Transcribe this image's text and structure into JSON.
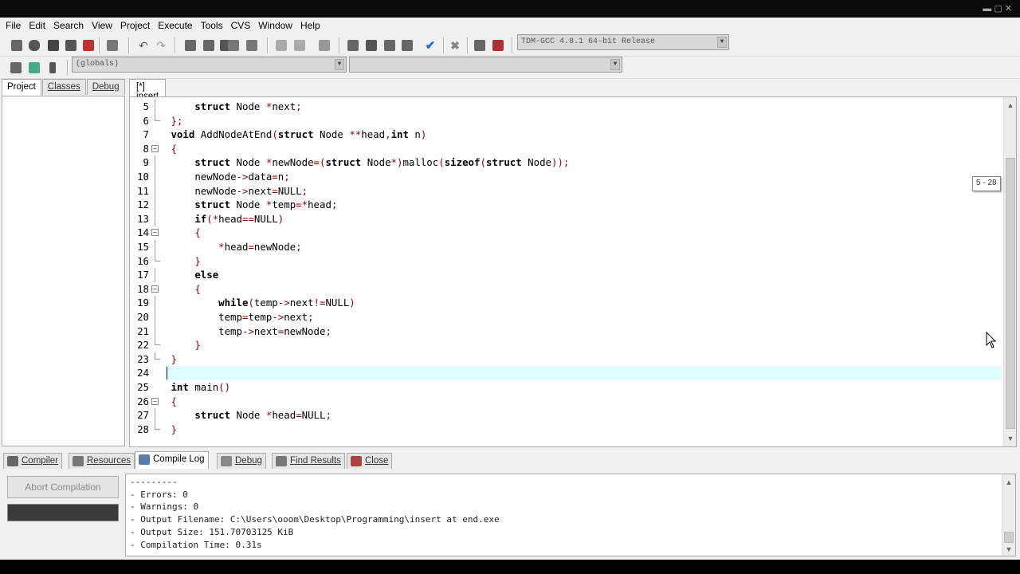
{
  "menubar": {
    "items": [
      "File",
      "Edit",
      "Search",
      "View",
      "Project",
      "Execute",
      "Tools",
      "CVS",
      "Window",
      "Help"
    ]
  },
  "toolbar": {
    "compiler_select": "TDM-GCC 4.8.1 64-bit Release",
    "scope_select": "(globals)"
  },
  "left_panel": {
    "tabs": [
      "Project",
      "Classes",
      "Debug"
    ]
  },
  "editor": {
    "tab_label": "[*] insert at end.c",
    "tooltip": "5 - 28",
    "lines": [
      {
        "num": "5",
        "text": "    struct Node *next;"
      },
      {
        "num": "6",
        "text": "};"
      },
      {
        "num": "7",
        "text": "void AddNodeAtEnd(struct Node **head,int n)"
      },
      {
        "num": "8",
        "text": "{"
      },
      {
        "num": "9",
        "text": "    struct Node *newNode=(struct Node*)malloc(sizeof(struct Node));"
      },
      {
        "num": "10",
        "text": "    newNode->data=n;"
      },
      {
        "num": "11",
        "text": "    newNode->next=NULL;"
      },
      {
        "num": "12",
        "text": "    struct Node *temp=*head;"
      },
      {
        "num": "13",
        "text": "    if(*head==NULL)"
      },
      {
        "num": "14",
        "text": "    {"
      },
      {
        "num": "15",
        "text": "        *head=newNode;"
      },
      {
        "num": "16",
        "text": "    }"
      },
      {
        "num": "17",
        "text": "    else"
      },
      {
        "num": "18",
        "text": "    {"
      },
      {
        "num": "19",
        "text": "        while(temp->next!=NULL)"
      },
      {
        "num": "20",
        "text": "        temp=temp->next;"
      },
      {
        "num": "21",
        "text": "        temp->next=newNode;"
      },
      {
        "num": "22",
        "text": "    }"
      },
      {
        "num": "23",
        "text": "}"
      },
      {
        "num": "24",
        "text": ""
      },
      {
        "num": "25",
        "text": "int main()"
      },
      {
        "num": "26",
        "text": "{"
      },
      {
        "num": "27",
        "text": "    struct Node *head=NULL;"
      },
      {
        "num": "28",
        "text": "}"
      }
    ]
  },
  "bottom_tabs": [
    "Compiler",
    "Resources",
    "Compile Log",
    "Debug",
    "Find Results",
    "Close"
  ],
  "compile_panel": {
    "abort_label": "Abort Compilation",
    "log_lines": [
      "---------",
      "- Errors: 0",
      "- Warnings: 0",
      "- Output Filename: C:\\Users\\ooom\\Desktop\\Programming\\insert at end.exe",
      "- Output Size: 151.70703125 KiB",
      "- Compilation Time: 0.31s"
    ]
  }
}
